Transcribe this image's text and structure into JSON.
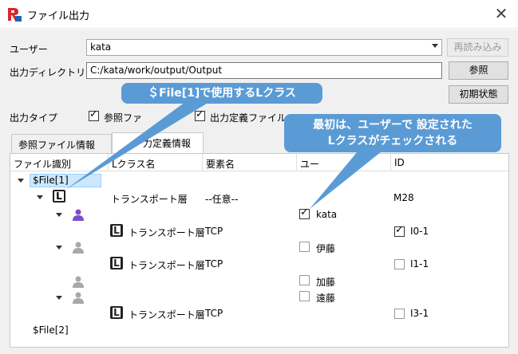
{
  "window": {
    "title": "ファイル出力",
    "close_glyph": "✕"
  },
  "form": {
    "user_label": "ユーザー",
    "user_value": "kata",
    "reload_label": "再読み込み",
    "outdir_label": "出力ディレクトリ",
    "outdir_value": "C:/kata/work/output/Output",
    "browse_label": "参照",
    "initial_label": "初期状態",
    "output_type_label": "出力タイプ",
    "ref_file_check": "参照ファ",
    "out_def_check": "出力定義ファイル"
  },
  "tabs": [
    {
      "label": "参照ファイル情報"
    },
    {
      "label": "力定義情報"
    }
  ],
  "columns": {
    "file_id": "ファイル識別",
    "lclass": "Lクラス名",
    "element": "要素名",
    "user": "ユー",
    "id": "ID"
  },
  "rows": {
    "file1": "$File[1]",
    "lclass1_name": "トランスポート層",
    "lclass1_element": "--任意--",
    "lclass1_id": "M28",
    "user_kata": "kata",
    "l_a_name": "トランスポート層",
    "l_a_element": "TCP",
    "l_a_id": "I0-1",
    "user_itou": "伊藤",
    "l_b_name": "トランスポート層",
    "l_b_element": "TCP",
    "l_b_id": "I1-1",
    "user_katou": "加藤",
    "user_endou": "遠藤",
    "l_c_name": "トランスポート層",
    "l_c_element": "TCP",
    "l_c_id": "I3-1",
    "file2": "$File[2]"
  },
  "callouts": {
    "top": "＄File[1]で使用するLクラス",
    "right_line1": "最初は、ユーザーで 設定された",
    "right_line2": "Lクラスがチェックされる"
  },
  "colors": {
    "callout": "#5b9bd5",
    "selection": "#cce8ff",
    "person_active": "#7b4fc9",
    "person_inactive": "#a8a8a8"
  }
}
